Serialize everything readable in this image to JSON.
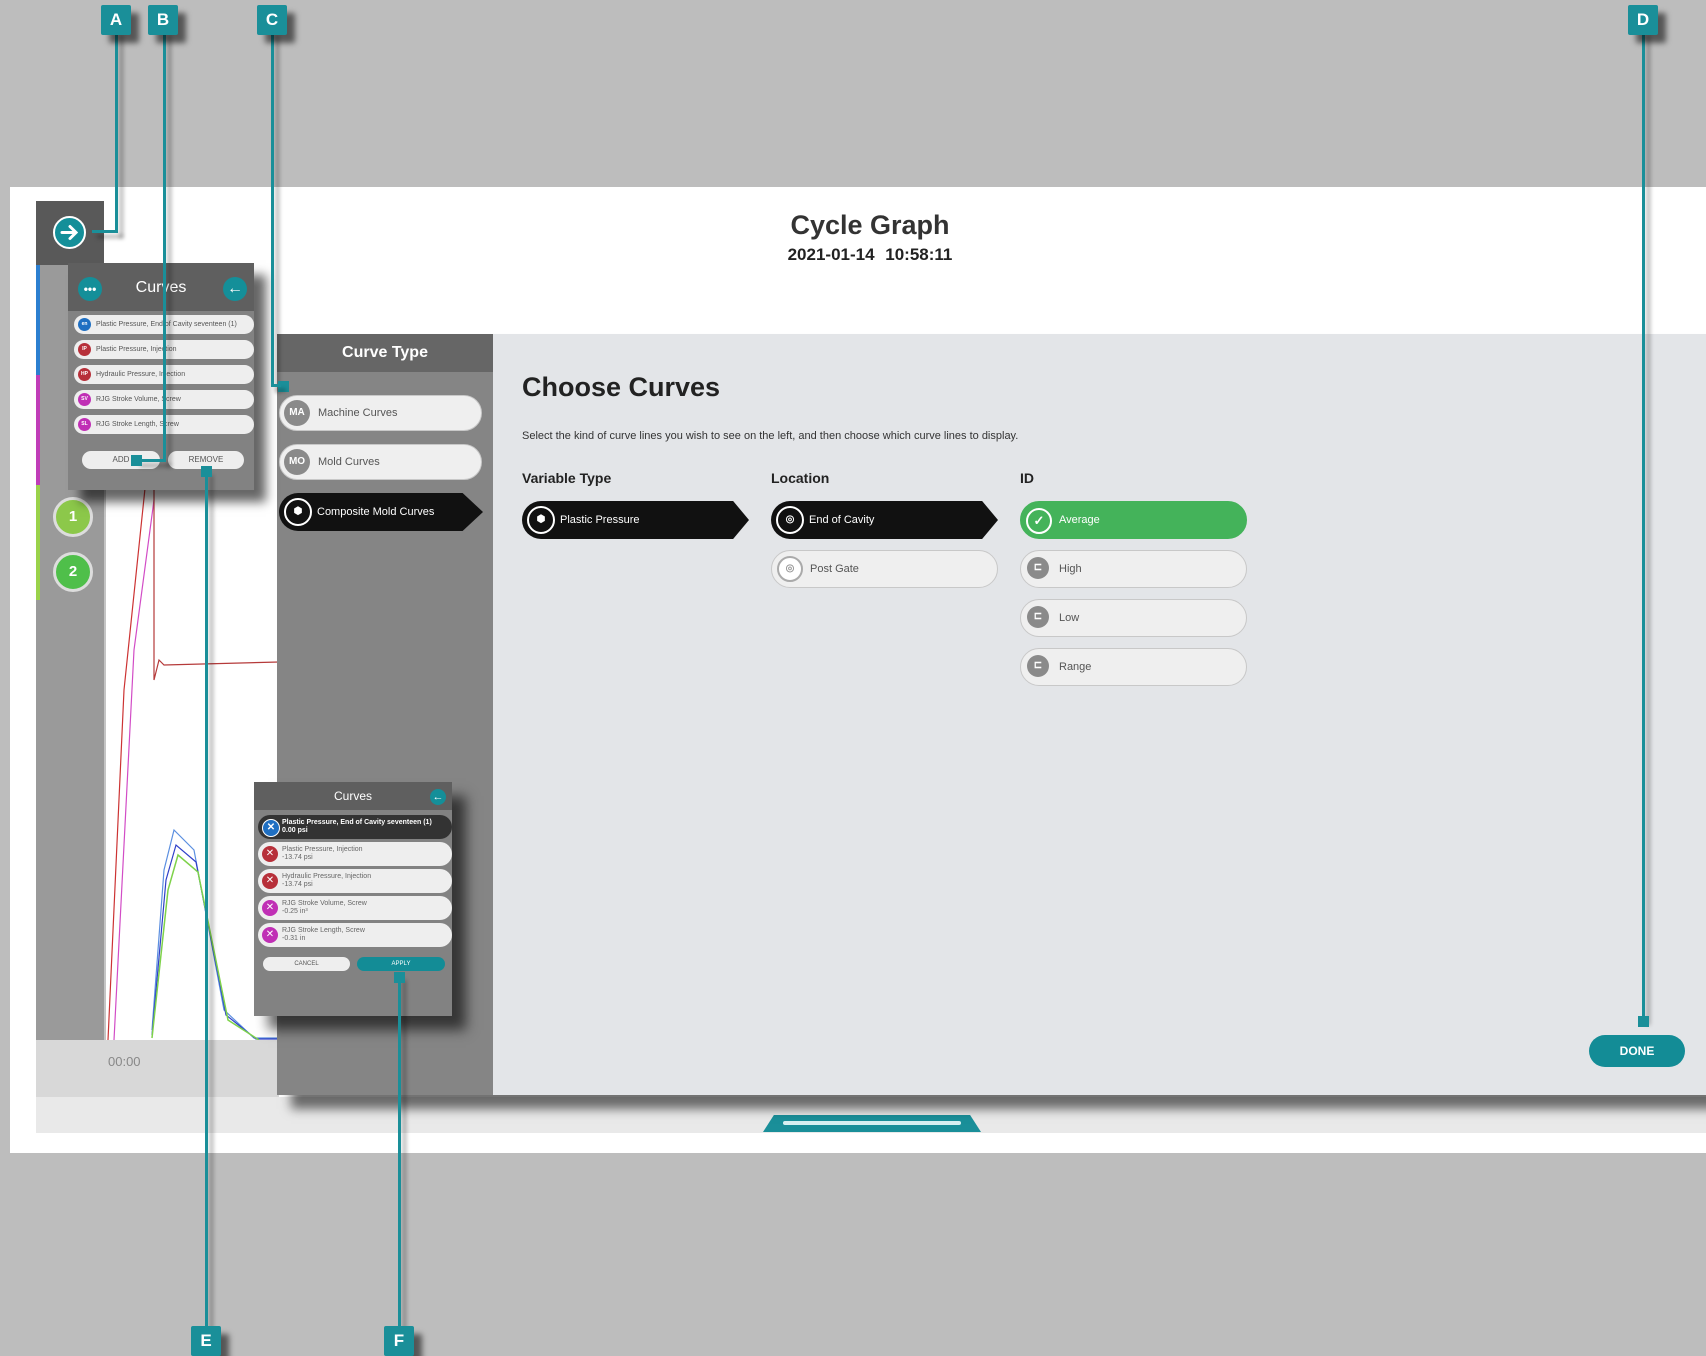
{
  "window": {
    "title": "Cycle Graph",
    "datetime": "2021-01-14   10:58:11"
  },
  "rail": {
    "items": [
      "1",
      "2"
    ]
  },
  "graph": {
    "axis_label": "00:00"
  },
  "curve_type": {
    "header": "Curve Type",
    "options": [
      {
        "abbr": "MA",
        "label": "Machine Curves"
      },
      {
        "abbr": "MO",
        "label": "Mold Curves"
      },
      {
        "abbr": "",
        "label": "Composite Mold Curves",
        "selected": true
      }
    ]
  },
  "chooser": {
    "title": "Choose Curves",
    "description": "Select the kind of curve lines you wish to see on the left, and then choose which curve lines to display.",
    "variable_type": {
      "heading": "Variable Type",
      "options": [
        {
          "label": "Plastic Pressure",
          "selected": true
        }
      ]
    },
    "location": {
      "heading": "Location",
      "options": [
        {
          "label": "End of Cavity",
          "selected": true
        },
        {
          "label": "Post Gate"
        }
      ]
    },
    "id": {
      "heading": "ID",
      "options": [
        {
          "label": "Average",
          "selected": true
        },
        {
          "label": "High"
        },
        {
          "label": "Low"
        },
        {
          "label": "Range"
        }
      ]
    },
    "done_label": "DONE"
  },
  "curves_panel": {
    "title": "Curves",
    "items": [
      {
        "abbr": "en",
        "label": "Plastic Pressure, End of Cavity seventeen (1)",
        "color": "#1f6fc2"
      },
      {
        "abbr": "IP",
        "label": "Plastic Pressure, Injection",
        "color": "#b7303a"
      },
      {
        "abbr": "HP",
        "label": "Hydraulic Pressure, Injection",
        "color": "#b7303a"
      },
      {
        "abbr": "SV",
        "label": "RJG Stroke Volume, Screw",
        "color": "#c02fb5"
      },
      {
        "abbr": "SL",
        "label": "RJG Stroke Length, Screw",
        "color": "#c02fb5"
      }
    ],
    "add_label": "ADD",
    "remove_label": "REMOVE"
  },
  "remove_panel": {
    "title": "Curves",
    "items": [
      {
        "label": "Plastic Pressure, End of Cavity seventeen (1)",
        "value": "0.00 psi",
        "color": "#1f6fc2",
        "selected": true
      },
      {
        "label": "Plastic Pressure, Injection",
        "value": "-13.74 psi",
        "color": "#b7303a"
      },
      {
        "label": "Hydraulic Pressure, Injection",
        "value": "-13.74 psi",
        "color": "#b7303a"
      },
      {
        "label": "RJG Stroke Volume, Screw",
        "value": "-0.25 in³",
        "color": "#c02fb5"
      },
      {
        "label": "RJG Stroke Length, Screw",
        "value": "-0.31 in",
        "color": "#c02fb5"
      }
    ],
    "cancel_label": "CANCEL",
    "apply_label": "APPLY"
  },
  "callouts": [
    "A",
    "B",
    "C",
    "D",
    "E",
    "F"
  ],
  "colors": {
    "accent": "#1a8f99",
    "selected_green": "#44b35a",
    "selected_black": "#111111"
  }
}
